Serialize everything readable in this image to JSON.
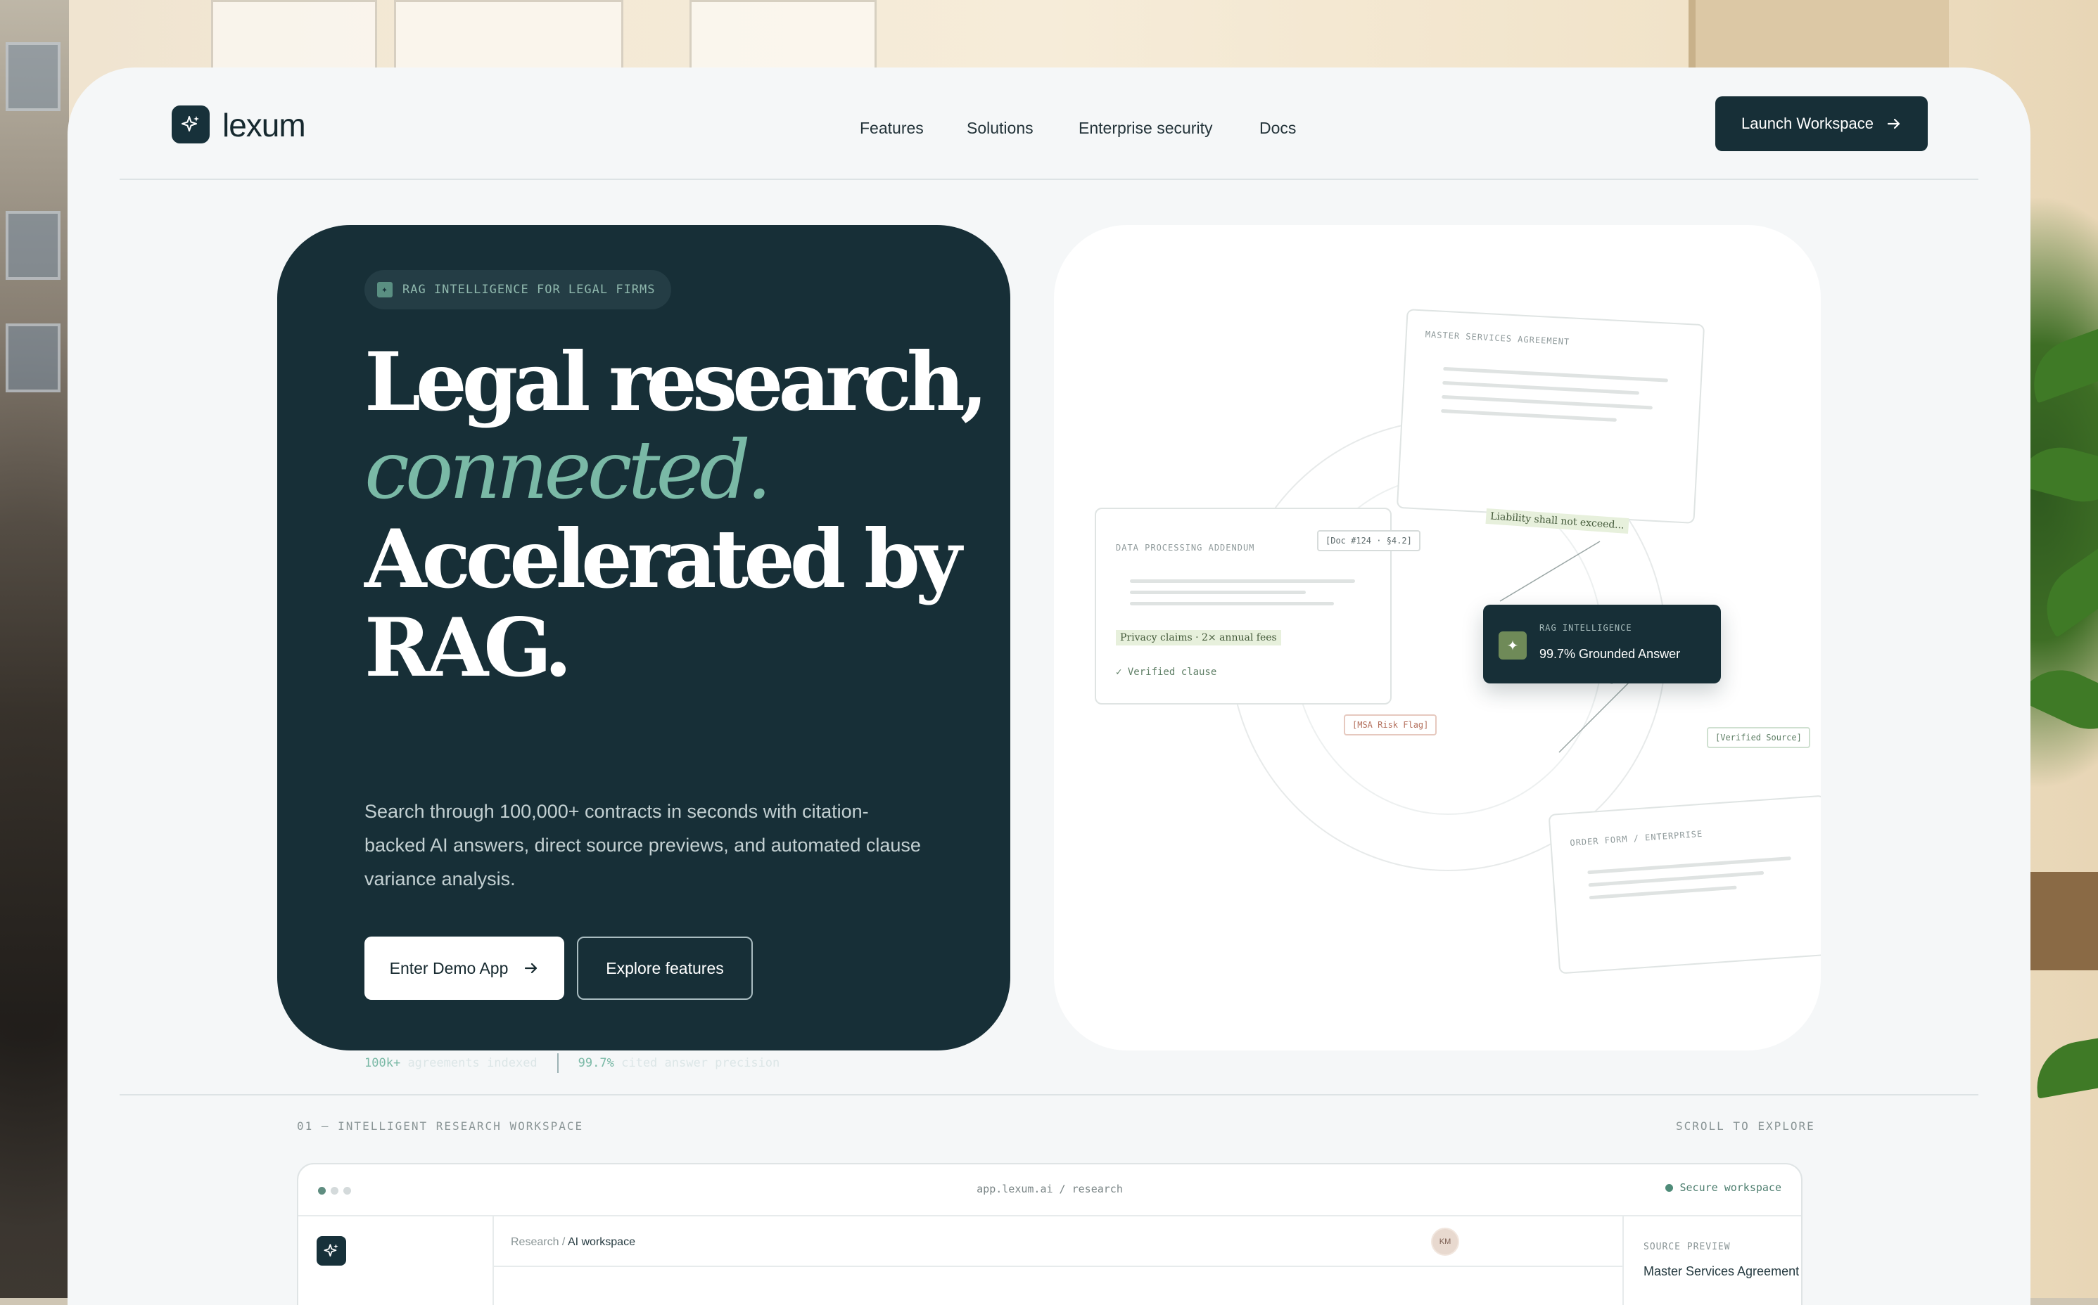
{
  "brand": {
    "name": "lexum"
  },
  "nav": {
    "items": [
      "Features",
      "Solutions",
      "Enterprise security",
      "Docs"
    ],
    "cta": "Launch Workspace"
  },
  "hero": {
    "eyebrow": "RAG INTELLIGENCE FOR LEGAL FIRMS",
    "headline": {
      "line1": "Legal research,",
      "line2": "connected.",
      "line3": "Accelerated by",
      "line4": "RAG."
    },
    "description": "Search through 100,000+ contracts in seconds with citation-backed AI answers, direct source previews, and automated clause variance analysis.",
    "primary_button": "Enter Demo App",
    "secondary_button": "Explore features",
    "stats": [
      {
        "value": "100k+",
        "label": "agreements indexed"
      },
      {
        "value": "99.7%",
        "label": "cited answer precision"
      }
    ]
  },
  "visual": {
    "doc_msa": "MASTER SERVICES AGREEMENT",
    "doc_dpa": "DATA PROCESSING ADDENDUM",
    "doc_order": "ORDER FORM / ENTERPRISE",
    "msa_highlight": "Liability shall not exceed...",
    "dpa_highlight": "Privacy claims · 2× annual fees",
    "dpa_verified": "✓ Verified clause",
    "tag_doc": "[Doc #124 · §4.2]",
    "tag_risk": "[MSA Risk Flag]",
    "tag_verified": "[Verified Source]",
    "rag_label": "RAG INTELLIGENCE",
    "rag_answer": "99.7% Grounded Answer"
  },
  "section": {
    "label": "01 — INTELLIGENT RESEARCH WORKSPACE",
    "scroll": "SCROLL TO EXPLORE"
  },
  "app_window": {
    "url": "app.lexum.ai / research",
    "status": "Secure workspace",
    "breadcrumb_root": "Research",
    "breadcrumb_current": "AI workspace",
    "avatar": "KM",
    "preview_label": "SOURCE PREVIEW",
    "preview_title": "Master Services Agreement"
  },
  "colors": {
    "primary": "#172f37",
    "accent": "#7ab9a6",
    "background": "#f5f7f8"
  }
}
